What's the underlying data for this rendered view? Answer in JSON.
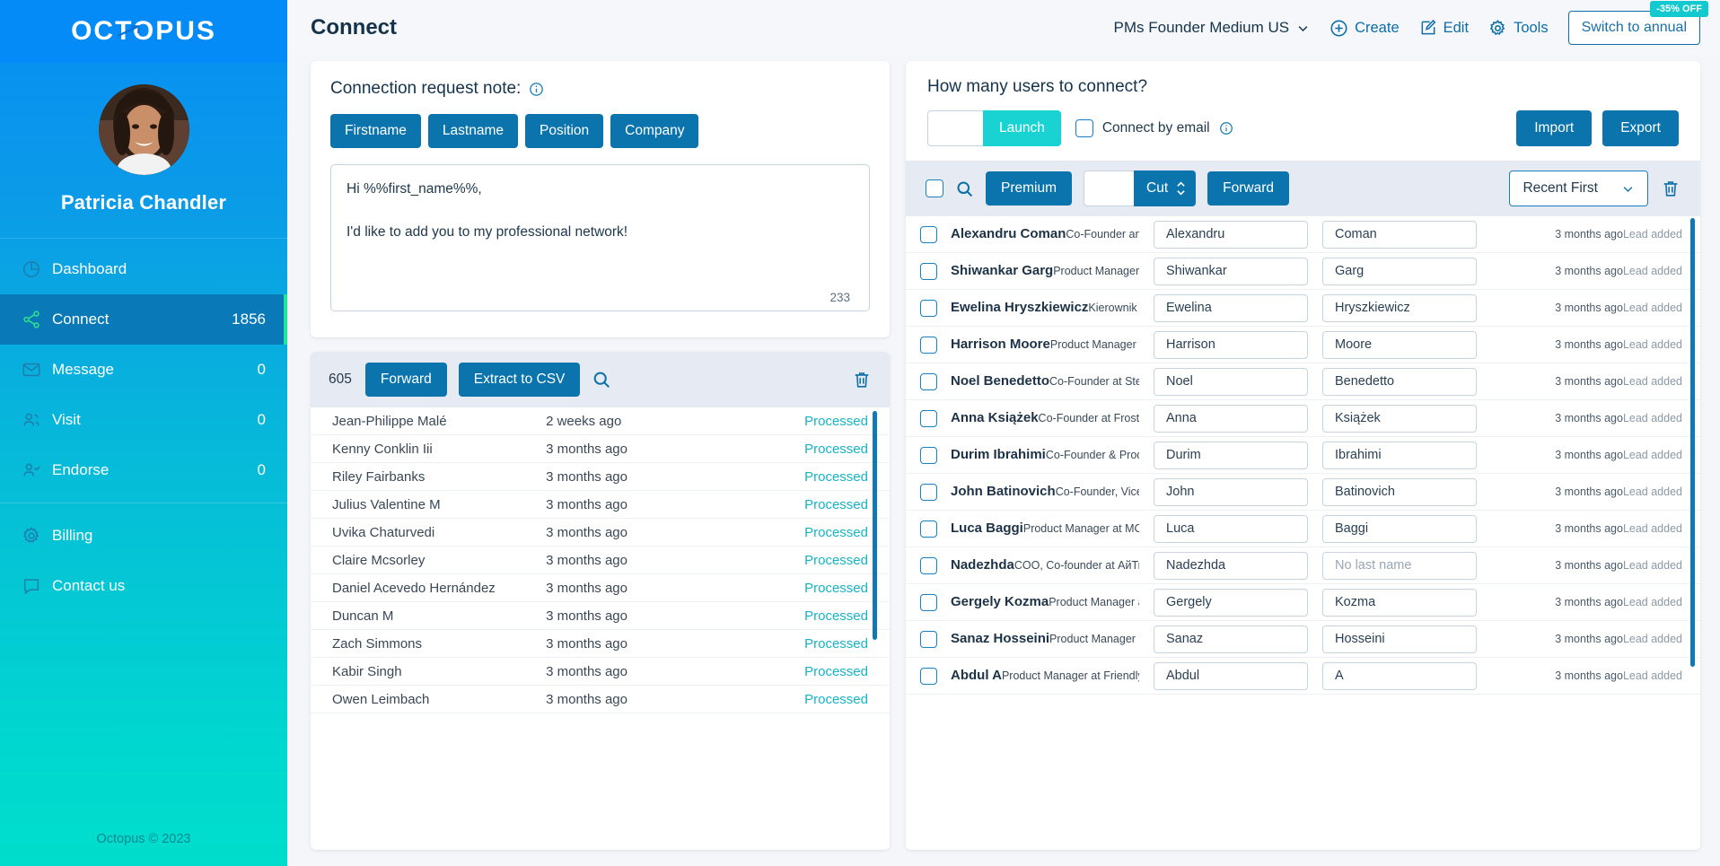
{
  "brand": {
    "logo_text": "OCTOPUS",
    "accent_blue": "#0b74ad",
    "accent_cyan": "#19d3d3",
    "accent_green": "#23e59a",
    "status_color": "#16b3c4"
  },
  "sidebar": {
    "profile_name": "Patricia Chandler",
    "items": [
      {
        "label": "Dashboard",
        "count": "",
        "icon": "dashboard-icon",
        "active": false
      },
      {
        "label": "Connect",
        "count": "1856",
        "icon": "share-icon",
        "active": true
      },
      {
        "label": "Message",
        "count": "0",
        "icon": "envelope-icon",
        "active": false
      },
      {
        "label": "Visit",
        "count": "0",
        "icon": "users-icon",
        "active": false
      },
      {
        "label": "Endorse",
        "count": "0",
        "icon": "user-check-icon",
        "active": false
      },
      {
        "label": "Billing",
        "count": "",
        "icon": "gear-icon",
        "active": false
      },
      {
        "label": "Contact us",
        "count": "",
        "icon": "chat-icon",
        "active": false
      }
    ],
    "footer": "Octopus © 2023"
  },
  "topbar": {
    "page_title": "Connect",
    "campaign": "PMs Founder Medium US",
    "create_label": "Create",
    "edit_label": "Edit",
    "tools_label": "Tools",
    "switch_label": "Switch to annual",
    "discount_badge": "-35% OFF"
  },
  "note_panel": {
    "heading": "Connection request note:",
    "tokens": [
      "Firstname",
      "Lastname",
      "Position",
      "Company"
    ],
    "message": "Hi %%first_name%%,\n\nI'd like to add you to my professional network!",
    "char_count": "233"
  },
  "processed_panel": {
    "count": "605",
    "forward_label": "Forward",
    "extract_label": "Extract to CSV",
    "rows": [
      {
        "name": "Jean-Philippe Malé",
        "time": "2 weeks ago",
        "status": "Processed"
      },
      {
        "name": "Kenny Conklin Iii",
        "time": "3 months ago",
        "status": "Processed"
      },
      {
        "name": "Riley Fairbanks",
        "time": "3 months ago",
        "status": "Processed"
      },
      {
        "name": "Julius Valentine M",
        "time": "3 months ago",
        "status": "Processed"
      },
      {
        "name": "Uvika Chaturvedi",
        "time": "3 months ago",
        "status": "Processed"
      },
      {
        "name": "Claire Mcsorley",
        "time": "3 months ago",
        "status": "Processed"
      },
      {
        "name": "Daniel Acevedo Hernández",
        "time": "3 months ago",
        "status": "Processed"
      },
      {
        "name": "Duncan M",
        "time": "3 months ago",
        "status": "Processed"
      },
      {
        "name": "Zach Simmons",
        "time": "3 months ago",
        "status": "Processed"
      },
      {
        "name": "Kabir Singh",
        "time": "3 months ago",
        "status": "Processed"
      },
      {
        "name": "Owen Leimbach",
        "time": "3 months ago",
        "status": "Processed"
      }
    ]
  },
  "users_panel": {
    "question": "How many users to connect?",
    "launch_value": "",
    "launch_label": "Launch",
    "connect_by_email_label": "Connect by email",
    "import_label": "Import",
    "export_label": "Export",
    "premium_label": "Premium",
    "cut_value": "",
    "cut_label": "Cut",
    "forward_label": "Forward",
    "sort_label": "Recent First",
    "no_last_name_placeholder": "No last name",
    "rows": [
      {
        "name": "Alexandru Coman",
        "role": "Co-Founder and Tech Lead at Foo...",
        "first": "Alexandru",
        "last": "Coman",
        "last_empty": false,
        "when": "3 months ago",
        "added": "Lead added"
      },
      {
        "name": "Shiwankar Garg",
        "role": "Product Manager at Autarco",
        "first": "Shiwankar",
        "last": "Garg",
        "last_empty": false,
        "when": "3 months ago",
        "added": "Lead added"
      },
      {
        "name": "Ewelina Hryszkiewicz",
        "role": "Kierownik produktu at NEXERA",
        "first": "Ewelina",
        "last": "Hryszkiewicz",
        "last_empty": false,
        "when": "3 months ago",
        "added": "Lead added"
      },
      {
        "name": "Harrison Moore",
        "role": "Product Manager at Fanwave Digi...",
        "first": "Harrison",
        "last": "Moore",
        "last_empty": false,
        "when": "3 months ago",
        "added": "Lead added"
      },
      {
        "name": "Noel Benedetto",
        "role": "Co-Founder at Stealth Startup",
        "first": "Noel",
        "last": "Benedetto",
        "last_empty": false,
        "when": "3 months ago",
        "added": "Lead added"
      },
      {
        "name": "Anna Książek",
        "role": "Co-Founder at Frost Line Sp. z o.o.",
        "first": "Anna",
        "last": "Książek",
        "last_empty": false,
        "when": "3 months ago",
        "added": "Lead added"
      },
      {
        "name": "Durim Ibrahimi",
        "role": "Co-Founder & Product Researche...",
        "first": "Durim",
        "last": "Ibrahimi",
        "last_empty": false,
        "when": "3 months ago",
        "added": "Lead added"
      },
      {
        "name": "John Batinovich",
        "role": "Co-Founder, Vice President of Bus...",
        "first": "John",
        "last": "Batinovich",
        "last_empty": false,
        "when": "3 months ago",
        "added": "Lead added"
      },
      {
        "name": "Luca Baggi",
        "role": "Product Manager at MC-monitori...",
        "first": "Luca",
        "last": "Baggi",
        "last_empty": false,
        "when": "3 months ago",
        "added": "Lead added"
      },
      {
        "name": "Nadezhda",
        "role": "COO, Co-founder at АйТи Пекарня",
        "first": "Nadezhda",
        "last": "No last name",
        "last_empty": true,
        "when": "3 months ago",
        "added": "Lead added"
      },
      {
        "name": "Gergely Kozma",
        "role": "Product Manager at Craft Docs",
        "first": "Gergely",
        "last": "Kozma",
        "last_empty": false,
        "when": "3 months ago",
        "added": "Lead added"
      },
      {
        "name": "Sanaz Hosseini",
        "role": "Product Manager at Campana Sys...",
        "first": "Sanaz",
        "last": "Hosseini",
        "last_empty": false,
        "when": "3 months ago",
        "added": "Lead added"
      },
      {
        "name": "Abdul A",
        "role": "Product Manager at FriendlyAVA",
        "first": "Abdul",
        "last": "A",
        "last_empty": false,
        "when": "3 months ago",
        "added": "Lead added"
      }
    ]
  }
}
